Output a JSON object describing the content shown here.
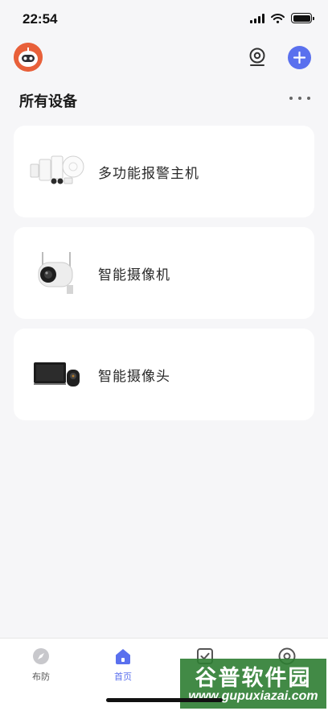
{
  "status_bar": {
    "time": "22:54"
  },
  "header": {
    "section_title": "所有设备"
  },
  "devices": [
    {
      "name": "多功能报警主机",
      "icon": "alarm-host-kit-icon"
    },
    {
      "name": "智能摄像机",
      "icon": "outdoor-camera-icon"
    },
    {
      "name": "智能摄像头",
      "icon": "video-doorbell-camera-icon"
    }
  ],
  "tabs": [
    {
      "label": "布防",
      "icon": "compass-icon",
      "active": false
    },
    {
      "label": "首页",
      "icon": "home-icon",
      "active": true
    },
    {
      "label": "",
      "icon": "checkbox-icon",
      "active": false
    },
    {
      "label": "",
      "icon": "profile-icon",
      "active": false
    }
  ],
  "watermark": {
    "text_cn": "谷普软件园",
    "text_en": "www.gupuxiazai.com"
  },
  "colors": {
    "accent": "#5a70ee",
    "background": "#f6f6f8",
    "card": "#ffffff",
    "avatar": "#e8603a"
  }
}
